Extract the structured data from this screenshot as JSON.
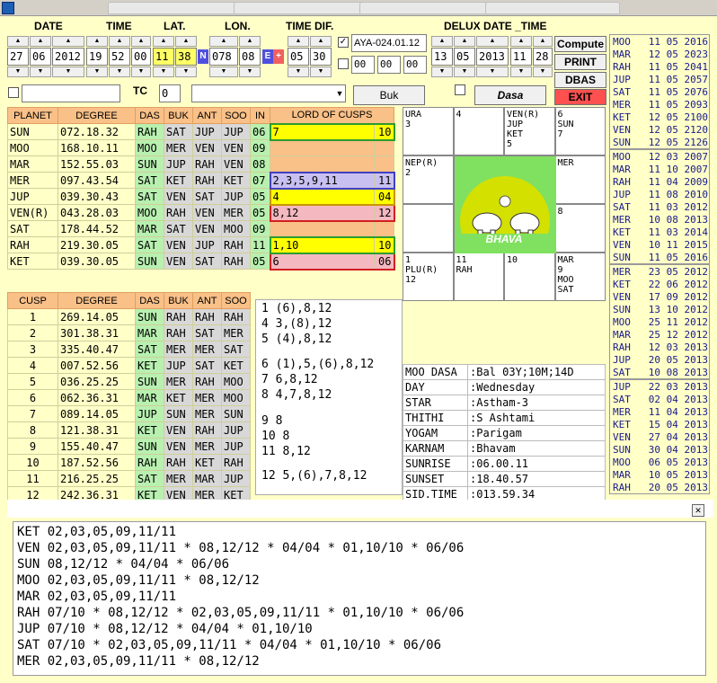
{
  "header": {
    "date": "DATE",
    "time": "TIME",
    "lat": "LAT.",
    "lon": "LON.",
    "timedif": "TIME DIF.",
    "delux": "DELUX DATE _TIME"
  },
  "inputs": {
    "day": "27",
    "month": "06",
    "year": "2012",
    "hour": "19",
    "min": "52",
    "sec": "00",
    "lat_deg": "11",
    "lat_min": "38",
    "lat_dir": "N",
    "lon_deg": "078",
    "lon_min": "08",
    "lon_dir": "E",
    "lon_sign": "+",
    "td_h": "05",
    "td_m": "30",
    "ayanamsa": "AYA-024.01.12",
    "t1": "00",
    "t2": "00",
    "t3": "00",
    "dd_day": "13",
    "dd_month": "05",
    "dd_year": "2013",
    "dd_hour": "11",
    "dd_min": "28",
    "tc_label": "TC",
    "tc_value": "0"
  },
  "buttons": {
    "compute": "Compute",
    "print": "PRINT",
    "dbas": "DBAS",
    "exit": "EXIT",
    "buk": "Buk",
    "dasa": "Dasa"
  },
  "planet_table": {
    "headers": [
      "PLANET",
      "DEGREE",
      "DAS",
      "BUK",
      "ANT",
      "SOO",
      "IN",
      "LORD OF CUSPS"
    ],
    "rows": [
      [
        "SUN",
        "072.18.32",
        "RAH",
        "SAT",
        "JUP",
        "JUP",
        "06",
        "7",
        "10"
      ],
      [
        "MOO",
        "168.10.11",
        "MOO",
        "MER",
        "VEN",
        "VEN",
        "09",
        "",
        ""
      ],
      [
        "MAR",
        "152.55.03",
        "SUN",
        "JUP",
        "RAH",
        "VEN",
        "08",
        "",
        ""
      ],
      [
        "MER",
        "097.43.54",
        "SAT",
        "KET",
        "RAH",
        "KET",
        "07",
        "2,3,5,9,11",
        "11"
      ],
      [
        "JUP",
        "039.30.43",
        "SAT",
        "VEN",
        "SAT",
        "JUP",
        "05",
        "4",
        "04"
      ],
      [
        "VEN(R)",
        "043.28.03",
        "MOO",
        "RAH",
        "VEN",
        "MER",
        "05",
        "8,12",
        "12"
      ],
      [
        "SAT",
        "178.44.52",
        "MAR",
        "SAT",
        "VEN",
        "MOO",
        "09",
        "",
        ""
      ],
      [
        "RAH",
        "219.30.05",
        "SAT",
        "VEN",
        "JUP",
        "RAH",
        "11",
        "1,10",
        "10"
      ],
      [
        "KET",
        "039.30.05",
        "SUN",
        "VEN",
        "SAT",
        "RAH",
        "05",
        "6",
        "06"
      ]
    ]
  },
  "cusp_table": {
    "headers": [
      "CUSP",
      "DEGREE",
      "DAS",
      "BUK",
      "ANT",
      "SOO"
    ],
    "rows": [
      [
        "1",
        "269.14.05",
        "SUN",
        "RAH",
        "RAH",
        "RAH"
      ],
      [
        "2",
        "301.38.31",
        "MAR",
        "RAH",
        "SAT",
        "MER"
      ],
      [
        "3",
        "335.40.47",
        "SAT",
        "MER",
        "MER",
        "SAT"
      ],
      [
        "4",
        "007.52.56",
        "KET",
        "JUP",
        "SAT",
        "KET"
      ],
      [
        "5",
        "036.25.25",
        "SUN",
        "MER",
        "RAH",
        "MOO"
      ],
      [
        "6",
        "062.36.31",
        "MAR",
        "KET",
        "MER",
        "MOO"
      ],
      [
        "7",
        "089.14.05",
        "JUP",
        "SUN",
        "MER",
        "SUN"
      ],
      [
        "8",
        "121.38.31",
        "KET",
        "VEN",
        "RAH",
        "JUP"
      ],
      [
        "9",
        "155.40.47",
        "SUN",
        "VEN",
        "MER",
        "JUP"
      ],
      [
        "10",
        "187.52.56",
        "RAH",
        "RAH",
        "KET",
        "RAH"
      ],
      [
        "11",
        "216.25.25",
        "SAT",
        "MER",
        "MAR",
        "JUP"
      ],
      [
        "12",
        "242.36.31",
        "KET",
        "VEN",
        "MER",
        "KET"
      ]
    ]
  },
  "cusp_sig": [
    "1  (6),8,12",
    "4  3,(8),12",
    "5  (4),8,12",
    "6  (1),5,(6),8,12",
    "7  6,8,12",
    "8  4,7,8,12",
    "9  8",
    "10  8",
    "11  8,12",
    "12  5,(6),7,8,12"
  ],
  "chart": {
    "c1": [
      "URA",
      "3"
    ],
    "c2": [
      "4"
    ],
    "c3": [
      "VEN(R)",
      "JUP",
      "KET",
      "5"
    ],
    "c4": [
      "6",
      "SUN",
      "7"
    ],
    "c5": [
      "NEP(R)",
      "2"
    ],
    "c8": [
      "MER"
    ],
    "c9": [
      ""
    ],
    "c12": [
      "8"
    ],
    "c13": [
      "1",
      "PLU(R)",
      "12"
    ],
    "c14": [
      "11",
      "RAH"
    ],
    "c15": [
      "10"
    ],
    "c16": [
      "MAR",
      "9",
      "MOO",
      "SAT"
    ],
    "logo_text": "BHAVA"
  },
  "details": [
    [
      "MOO DASA",
      ":Bal 03Y;10M;14D"
    ],
    [
      "DAY",
      ":Wednesday"
    ],
    [
      "STAR",
      ":Astham-3"
    ],
    [
      "THITHI",
      ":S Ashtami"
    ],
    [
      "YOGAM",
      ":Parigam"
    ],
    [
      "KARNAM",
      ":Bhavam"
    ],
    [
      "SUNRISE",
      ":06.00.11"
    ],
    [
      "SUNSET",
      ":18.40.57"
    ],
    [
      "SID.TIME",
      ":013.59.34"
    ]
  ],
  "side_list": [
    [
      "MOO",
      "11 05 2016"
    ],
    [
      "MAR",
      "12 05 2023"
    ],
    [
      "RAH",
      "11 05 2041"
    ],
    [
      "JUP",
      "11 05 2057"
    ],
    [
      "SAT",
      "11 05 2076"
    ],
    [
      "MER",
      "11 05 2093"
    ],
    [
      "KET",
      "12 05 2100"
    ],
    [
      "VEN",
      "12 05 2120"
    ],
    [
      "SUN",
      "12 05 2126"
    ],
    [
      "MOO",
      "12 03 2007"
    ],
    [
      "MAR",
      "11 10 2007"
    ],
    [
      "RAH",
      "11 04 2009"
    ],
    [
      "JUP",
      "11 08 2010"
    ],
    [
      "SAT",
      "11 03 2012"
    ],
    [
      "MER",
      "10 08 2013"
    ],
    [
      "KET",
      "11 03 2014"
    ],
    [
      "VEN",
      "10 11 2015"
    ],
    [
      "SUN",
      "11 05 2016"
    ],
    [
      "MER",
      "23 05 2012"
    ],
    [
      "KET",
      "22 06 2012"
    ],
    [
      "VEN",
      "17 09 2012"
    ],
    [
      "SUN",
      "13 10 2012"
    ],
    [
      "MOO",
      "25 11 2012"
    ],
    [
      "MAR",
      "25 12 2012"
    ],
    [
      "RAH",
      "12 03 2013"
    ],
    [
      "JUP",
      "20 05 2013"
    ],
    [
      "SAT",
      "10 08 2013"
    ],
    [
      "JUP",
      "22 03 2013"
    ],
    [
      "SAT",
      "02 04 2013"
    ],
    [
      "MER",
      "11 04 2013"
    ],
    [
      "KET",
      "15 04 2013"
    ],
    [
      "VEN",
      "27 04 2013"
    ],
    [
      "SUN",
      "30 04 2013"
    ],
    [
      "MOO",
      "06 05 2013"
    ],
    [
      "MAR",
      "10 05 2013"
    ],
    [
      "RAH",
      "20 05 2013"
    ]
  ],
  "bottom_lines": [
    "KET 02,03,05,09,11/11",
    "VEN 02,03,05,09,11/11 * 08,12/12 * 04/04 * 01,10/10 * 06/06",
    "SUN 08,12/12 * 04/04 * 06/06",
    "MOO 02,03,05,09,11/11 * 08,12/12",
    "MAR 02,03,05,09,11/11",
    "RAH 07/10 * 08,12/12 * 02,03,05,09,11/11 * 01,10/10 * 06/06",
    "JUP 07/10 * 08,12/12 * 04/04 * 01,10/10",
    "SAT 07/10 * 02,03,05,09,11/11 * 04/04 * 01,10/10 * 06/06",
    "MER 02,03,05,09,11/11 * 08,12/12"
  ],
  "colors": {
    "bg": "#ffffc8",
    "header": "#f9c088",
    "green": "#b8f0b0",
    "yellow": "#ffff00",
    "pink": "#f4b8c0",
    "lavender": "#c8c0f0"
  }
}
